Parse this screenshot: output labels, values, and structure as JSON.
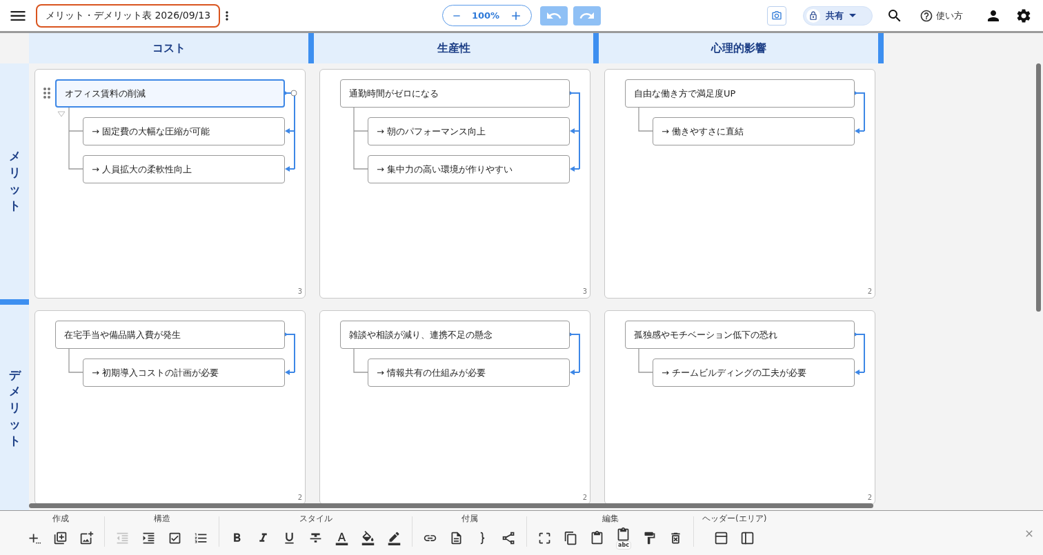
{
  "title": "メリット・デメリット表 2026/09/13",
  "zoom": "100%",
  "share": "共有",
  "help": "使い方",
  "columns": [
    "コスト",
    "生産性",
    "心理的影響"
  ],
  "rows": [
    {
      "label": "メリット",
      "cells": [
        {
          "parent": {
            "text": "オフィス賃料の削減",
            "selected": true
          },
          "children": [
            "→ 固定費の大幅な圧縮が可能",
            "→ 人員拡大の柔軟性向上"
          ],
          "count": "3"
        },
        {
          "parent": {
            "text": "通勤時間がゼロになる",
            "selected": false
          },
          "children": [
            "→ 朝のパフォーマンス向上",
            "→ 集中力の高い環境が作りやすい"
          ],
          "count": "3"
        },
        {
          "parent": {
            "text": "自由な働き方で満足度UP",
            "selected": false
          },
          "children": [
            "→ 働きやすさに直結"
          ],
          "count": "2"
        }
      ]
    },
    {
      "label": "デメリット",
      "cells": [
        {
          "parent": {
            "text": "在宅手当や備品購入費が発生",
            "selected": false
          },
          "children": [
            "→ 初期導入コストの計画が必要"
          ],
          "count": "2"
        },
        {
          "parent": {
            "text": "雑談や相談が減り、連携不足の懸念",
            "selected": false
          },
          "children": [
            "→ 情報共有の仕組みが必要"
          ],
          "count": "2"
        },
        {
          "parent": {
            "text": "孤独感やモチベーション低下の恐れ",
            "selected": false
          },
          "children": [
            "→ チームビルディングの工夫が必要"
          ],
          "count": "2"
        }
      ]
    }
  ],
  "toolbar": [
    {
      "label": "作成",
      "tools": [
        {
          "kind": "add",
          "disabled": false
        },
        {
          "kind": "duplicate",
          "disabled": false
        },
        {
          "kind": "image",
          "disabled": false
        }
      ]
    },
    {
      "label": "構造",
      "tools": [
        {
          "kind": "outdent",
          "disabled": true
        },
        {
          "kind": "indent",
          "disabled": false
        },
        {
          "kind": "checkbox",
          "disabled": false
        },
        {
          "kind": "numbered",
          "disabled": false
        }
      ]
    },
    {
      "label": "スタイル",
      "tools": [
        {
          "kind": "bold",
          "disabled": false
        },
        {
          "kind": "italic",
          "disabled": false
        },
        {
          "kind": "underline",
          "disabled": false
        },
        {
          "kind": "strike",
          "disabled": false
        },
        {
          "kind": "text-color",
          "disabled": false
        },
        {
          "kind": "fill",
          "disabled": false
        },
        {
          "kind": "border",
          "disabled": false
        }
      ]
    },
    {
      "label": "付属",
      "tools": [
        {
          "kind": "link",
          "disabled": false
        },
        {
          "kind": "note",
          "disabled": false
        },
        {
          "kind": "brace",
          "disabled": false
        },
        {
          "kind": "tree",
          "disabled": false
        }
      ]
    },
    {
      "label": "編集",
      "tools": [
        {
          "kind": "select-all",
          "disabled": false
        },
        {
          "kind": "copy",
          "disabled": false
        },
        {
          "kind": "paste",
          "disabled": false
        },
        {
          "kind": "paste-text",
          "disabled": false,
          "badge": "abc"
        },
        {
          "kind": "format-paint",
          "disabled": false
        },
        {
          "kind": "delete",
          "disabled": false
        }
      ]
    },
    {
      "label": "ヘッダー(エリア)",
      "tools": [
        {
          "kind": "header-top",
          "disabled": false
        },
        {
          "kind": "header-left",
          "disabled": false
        }
      ]
    }
  ]
}
